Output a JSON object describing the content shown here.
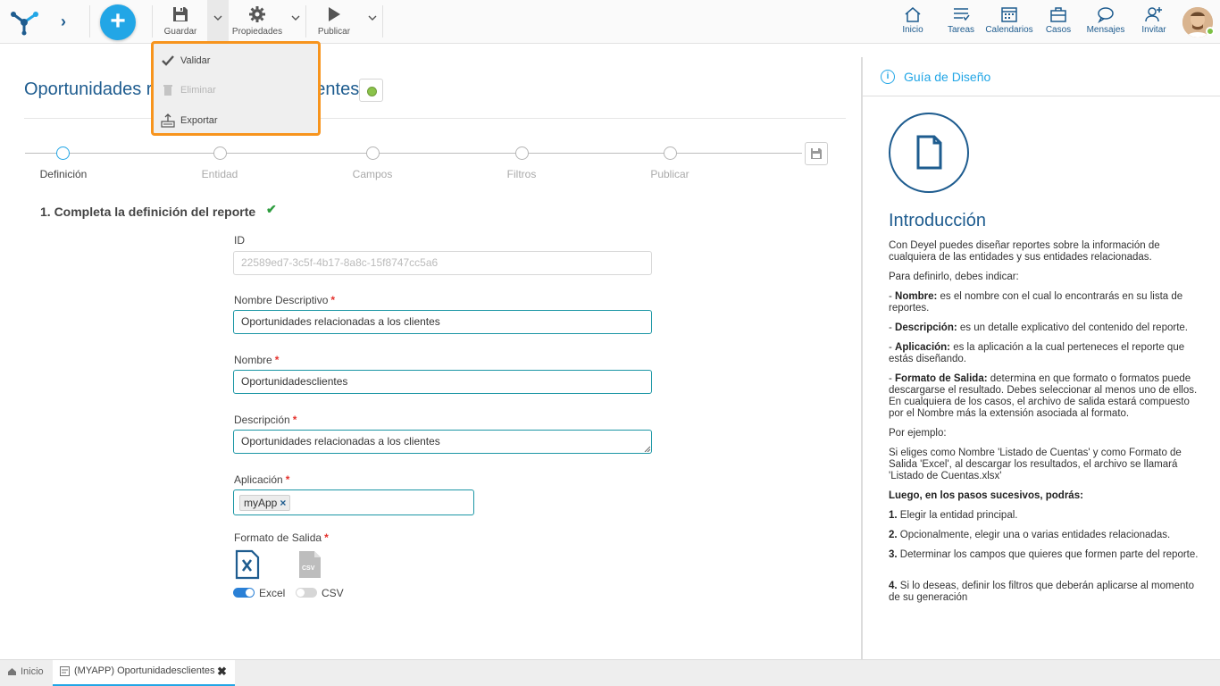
{
  "toolbar": {
    "guardar": "Guardar",
    "propiedades": "Propiedades",
    "publicar": "Publicar"
  },
  "dropdown": {
    "items": [
      {
        "label": "Validar",
        "icon": "check-icon",
        "enabled": true
      },
      {
        "label": "Eliminar",
        "icon": "trash-icon",
        "enabled": false
      },
      {
        "label": "Exportar",
        "icon": "export-icon",
        "enabled": true
      }
    ]
  },
  "nav": {
    "inicio": "Inicio",
    "tareas": "Tareas",
    "calendarios": "Calendarios",
    "casos": "Casos",
    "mensajes": "Mensajes",
    "invitar": "Invitar"
  },
  "page": {
    "title_left": "Oportunidades r",
    "title_right": "lientes"
  },
  "steps": [
    "Definición",
    "Entidad",
    "Campos",
    "Filtros",
    "Publicar"
  ],
  "section": {
    "title": "1. Completa la definición del reporte",
    "check": "✔"
  },
  "form": {
    "id_label": "ID",
    "id_value": "22589ed7-3c5f-4b17-8a8c-15f8747cc5a6",
    "nombre_desc_label": "Nombre Descriptivo",
    "nombre_desc_value": "Oportunidades relacionadas a los clientes",
    "nombre_label": "Nombre",
    "nombre_value": "Oportunidadesclientes",
    "descripcion_label": "Descripción",
    "descripcion_value": "Oportunidades relacionadas a los clientes",
    "aplicacion_label": "Aplicación",
    "aplicacion_tag": "myApp",
    "tag_remove": "×",
    "formato_label": "Formato de Salida",
    "formato_excel": "Excel",
    "formato_csv": "CSV",
    "required_mark": "*"
  },
  "panel": {
    "header": "Guía de Diseño",
    "info_glyph": "i",
    "heading": "Introducción",
    "p1": "Con Deyel puedes diseñar reportes sobre la información de cualquiera de las entidades y sus entidades relacionadas.",
    "p2": "Para definirlo, debes indicar:",
    "b_nombre": "Nombre:",
    "t_nombre": " es el nombre con el cual lo encontrarás en su lista de reportes.",
    "b_desc": "Descripción:",
    "t_desc": " es un detalle explicativo del contenido del reporte.",
    "b_app": "Aplicación:",
    "t_app": " es la aplicación a la cual perteneces el reporte que estás diseñando.",
    "b_fmt": "Formato de Salida:",
    "t_fmt": " determina en que formato o formatos puede descargarse el resultado. Debes seleccionar al menos uno de ellos. En cualquiera de los casos, el archivo de salida estará compuesto por el Nombre más la extensión asociada al formato.",
    "p_ej": "Por ejemplo:",
    "p_ej_text": "Si eliges como Nombre 'Listado de Cuentas' y como Formato de Salida 'Excel', al descargar los resultados, el archivo se llamará 'Listado de Cuentas.xlsx'",
    "p_luego": "Luego, en los pasos sucesivos, podrás:",
    "n1": "1.",
    "s1": " Elegir la entidad principal.",
    "n2": "2.",
    "s2": " Opcionalmente, elegir una o varias entidades relacionadas.",
    "n3": "3.",
    "s3": " Determinar los campos que quieres que formen parte del reporte.",
    "n4": "4.",
    "s4": " Si lo deseas, definir los filtros que deberán aplicarse al momento de su generación",
    "dash": "- "
  },
  "bottom": {
    "home": "Inicio",
    "tab": "(MYAPP) Oportunidadesclientes",
    "close": "✖"
  },
  "colors": {
    "accent": "#22a6e6",
    "brand": "#1e5c8f",
    "highlight": "#f7941d",
    "success": "#2e9d3f"
  }
}
